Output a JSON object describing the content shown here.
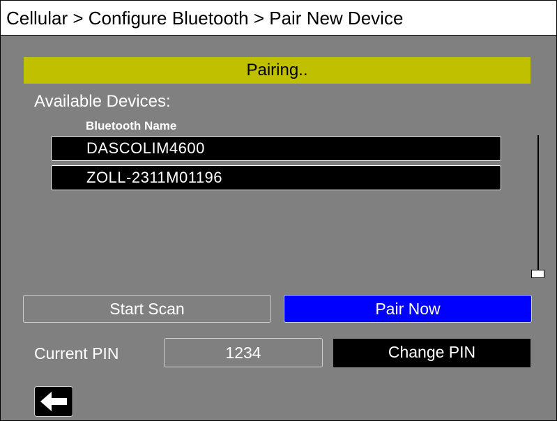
{
  "breadcrumb": "Cellular > Configure Bluetooth > Pair New Device",
  "status": "Pairing..",
  "devices": {
    "section_label": "Available Devices:",
    "column_header": "Bluetooth Name",
    "items": [
      {
        "name": "DASCOLIM4600"
      },
      {
        "name": "ZOLL-2311M01196"
      }
    ]
  },
  "actions": {
    "start_scan": "Start Scan",
    "pair_now": "Pair Now"
  },
  "pin": {
    "label": "Current PIN",
    "value": "1234",
    "change_label": "Change PIN"
  },
  "icons": {
    "back": "back-arrow-icon"
  },
  "colors": {
    "background": "#808080",
    "status_bar": "#c0c000",
    "pair_button": "#0000ff",
    "list_row": "#000000"
  }
}
